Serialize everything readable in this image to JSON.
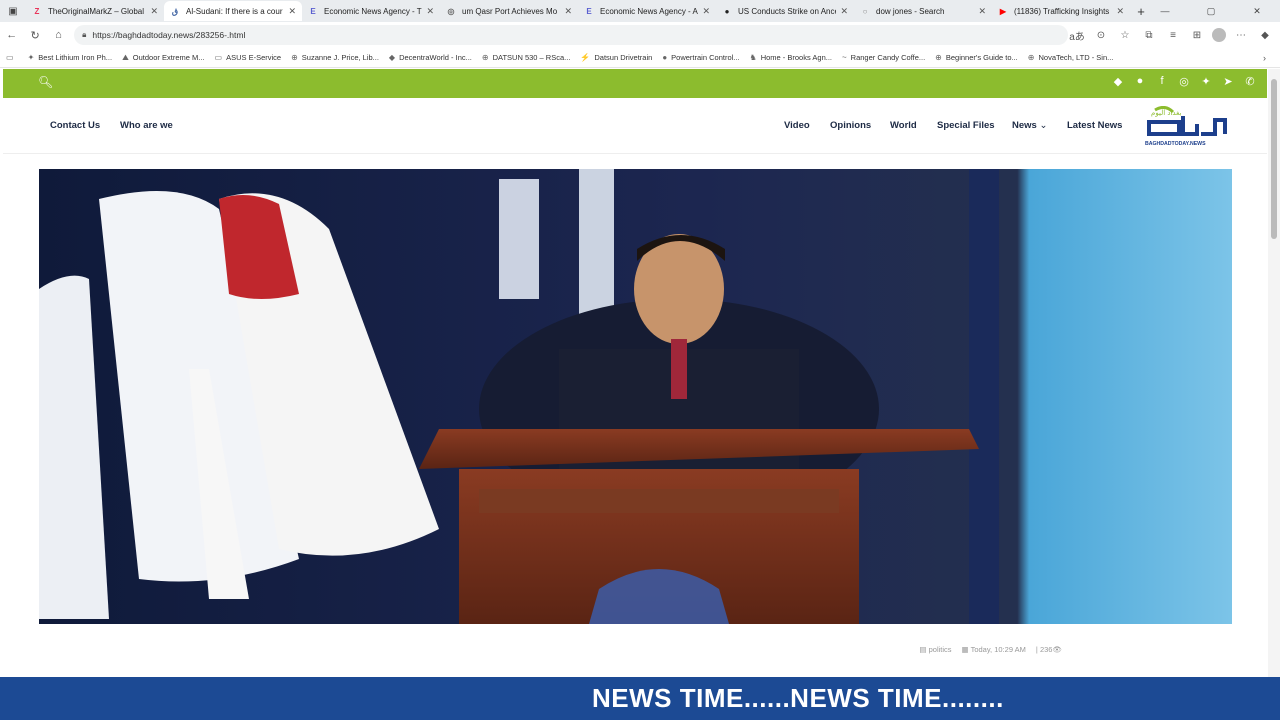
{
  "browser": {
    "tabs": [
      {
        "icon": "Z",
        "icon_color": "#e8355a",
        "label": "TheOriginalMarkZ – Global",
        "active": false
      },
      {
        "icon": "ق",
        "icon_color": "#3a5fa0",
        "label": "Al-Sudani: If there is a cour",
        "active": true
      },
      {
        "icon": "E",
        "icon_color": "#5a5fd0",
        "label": "Economic News Agency - Th",
        "active": false
      },
      {
        "icon": "◎",
        "icon_color": "#666666",
        "label": "um Qasr Port Achieves Mo",
        "active": false
      },
      {
        "icon": "E",
        "icon_color": "#5a5fd0",
        "label": "Economic News Agency - A",
        "active": false
      },
      {
        "icon": "●",
        "icon_color": "#222222",
        "label": "US Conducts Strike on Ance",
        "active": false
      },
      {
        "icon": "○",
        "icon_color": "#888888",
        "label": "dow jones - Search",
        "active": false
      },
      {
        "icon": "▶",
        "icon_color": "#ff0000",
        "label": "(11836) Trafficking Insights",
        "active": false
      }
    ],
    "url": "https://baghdadtoday.news/283256-.html",
    "bookmarks": [
      "Best Lithium Iron Ph...",
      "Outdoor Extreme M...",
      "ASUS E-Service",
      "Suzanne J. Price, Lib...",
      "DecentraWorld - Inc...",
      "DATSUN 530 – RSca...",
      "Datsun Drivetrain",
      "Powertrain Control...",
      "Home - Brooks Agn...",
      "Ranger Candy Coffe...",
      "Beginner's Guide to...",
      "NovaTech, LTD - Sin..."
    ]
  },
  "site": {
    "nav_left": [
      "Contact Us",
      "Who are we"
    ],
    "nav_right": [
      "Video",
      "Opinions",
      "World",
      "Special Files",
      "News",
      "Latest News"
    ],
    "logo_text_ar": "بغداد اليوم",
    "logo_text_en": "BAGHDADTODAY.NEWS",
    "accent_color": "#8cbc2e",
    "article_meta": {
      "category": "politics",
      "time": "Today, 10:29 AM",
      "views": "236"
    }
  },
  "ticker": {
    "text": "NEWS TIME......NEWS TIME........",
    "color": "#1c4a94"
  }
}
